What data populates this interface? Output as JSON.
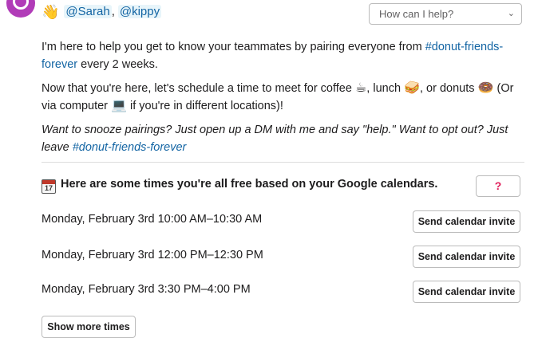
{
  "message": {
    "wave_emoji": "👋",
    "mention_sarah": "@Sarah",
    "mention_separator": ",",
    "mention_kippy": "@kippy",
    "help_select": {
      "placeholder": "How can I help?"
    },
    "intro_text": "I'm here to help you get to know your teammates by pairing everyone from",
    "channel_link": "#donut-friends-forever",
    "intro_suffix": "every 2 weeks.",
    "schedule_line_1_text": "Now that you're here, let's schedule a time to meet for coffee",
    "coffee_emoji": "☕",
    "comma_lunch": ", lunch",
    "lunch_emoji": "🥪",
    "or_donuts": ", or donuts",
    "donut_emoji": "🍩",
    "via_computer": "(Or via computer",
    "computer_emoji": "💻",
    "different_locations": "if you're in different locations)!",
    "snooze_text": "Want to snooze pairings? Just open up a DM with me and say \"help.\" Want to opt out? Just leave",
    "snooze_channel": "#donut-friends-forever"
  },
  "calendar": {
    "icon_number": "17",
    "header": "Here are some times you're all free based on your Google calendars.",
    "question_button": "?",
    "slots": [
      {
        "time": "Monday, February 3rd 10:00 AM–10:30 AM",
        "button": "Send calendar invite"
      },
      {
        "time": "Monday, February 3rd 12:00 PM–12:30 PM",
        "button": "Send calendar invite"
      },
      {
        "time": "Monday, February 3rd 3:30 PM–4:00 PM",
        "button": "Send calendar invite"
      }
    ],
    "more_button": "Show more times"
  }
}
